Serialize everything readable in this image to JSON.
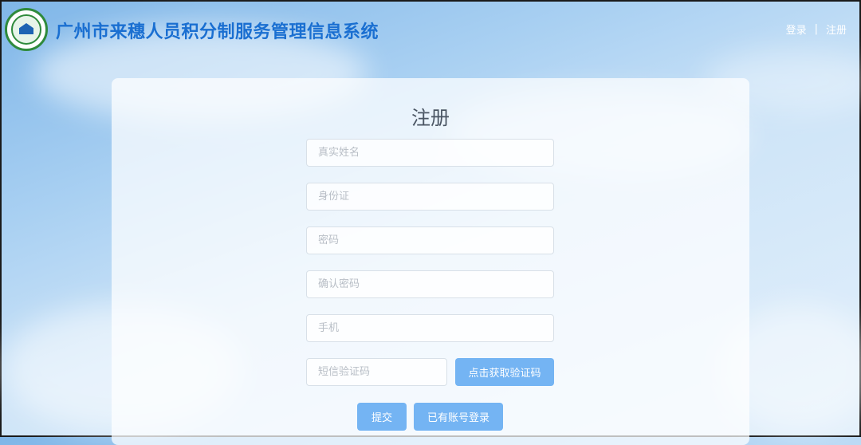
{
  "header": {
    "title": "广州市来穗人员积分制服务管理信息系统",
    "links": {
      "login": "登录",
      "separator": "|",
      "register": "注册"
    },
    "logo_icon": "house-seal-logo-icon"
  },
  "form": {
    "title": "注册",
    "fields": {
      "real_name": {
        "placeholder": "真实姓名",
        "value": ""
      },
      "id_card": {
        "placeholder": "身份证",
        "value": ""
      },
      "password": {
        "placeholder": "密码",
        "value": ""
      },
      "confirm_password": {
        "placeholder": "确认密码",
        "value": ""
      },
      "phone": {
        "placeholder": "手机",
        "value": ""
      },
      "sms_code": {
        "placeholder": "短信验证码",
        "value": ""
      }
    },
    "get_code_label": "点击获取验证码",
    "submit_label": "提交",
    "have_account_label": "已有账号登录"
  },
  "colors": {
    "title_blue": "#1a6fd1",
    "button_blue": "#74b4f3",
    "logo_green": "#2f8a3c"
  }
}
